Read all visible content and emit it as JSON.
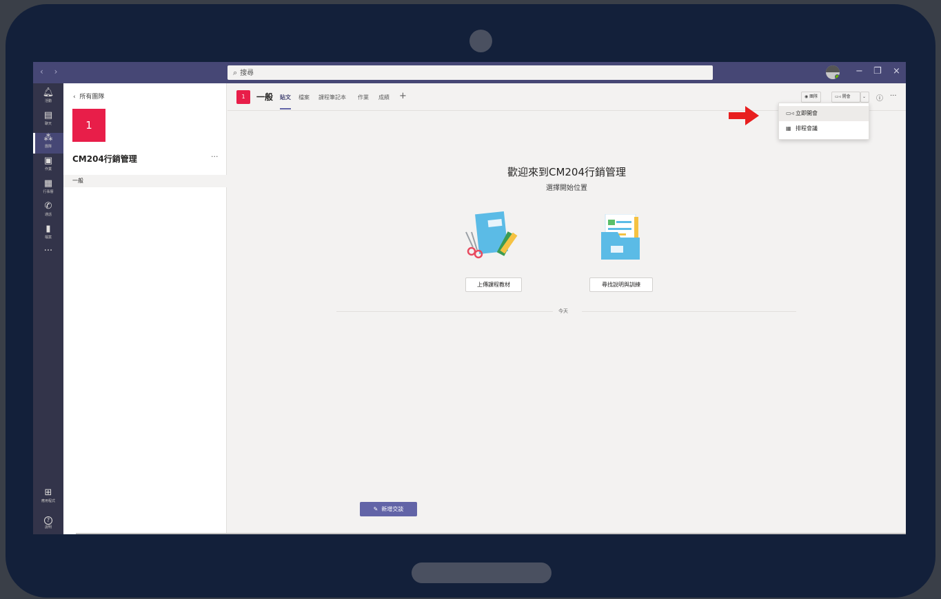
{
  "titlebar": {
    "nav_arrows": "‹ ›",
    "search_icon": "search-icon",
    "search_placeholder": "搜尋",
    "window_controls": [
      "−",
      "❐",
      "×"
    ]
  },
  "rail": {
    "items": [
      {
        "label": "活動",
        "icon": "bell-icon",
        "glyph": "🔔︎"
      },
      {
        "label": "聊天",
        "icon": "chat-icon",
        "glyph": "▤"
      },
      {
        "label": "團隊",
        "icon": "teams-icon",
        "glyph": "⁂"
      },
      {
        "label": "作業",
        "icon": "assignments-icon",
        "glyph": "▣"
      },
      {
        "label": "行事曆",
        "icon": "calendar-icon",
        "glyph": "▦"
      },
      {
        "label": "通話",
        "icon": "phone-icon",
        "glyph": "✆"
      },
      {
        "label": "檔案",
        "icon": "file-icon",
        "glyph": "▮"
      },
      {
        "label": "",
        "icon": "more-icon",
        "glyph": "···"
      }
    ],
    "bottom": [
      {
        "label": "應用程式",
        "icon": "apps-icon",
        "glyph": "⊞"
      },
      {
        "label": "說明",
        "icon": "help-icon",
        "glyph": "?"
      }
    ]
  },
  "team_panel": {
    "back_label": "所有團隊",
    "team_avatar": "1",
    "team_name": "CM204行銷管理",
    "more": "···",
    "channels": [
      "一般"
    ]
  },
  "channel_header": {
    "avatar": "1",
    "title": "一般",
    "tabs": [
      "貼文",
      "檔案",
      "課程筆記本",
      "作業",
      "成績"
    ],
    "add_tab": "+",
    "team_button": "團隊",
    "meet_button": "開會",
    "chevron": "⌄",
    "info": "ⓘ",
    "more": "···"
  },
  "meet_dropdown": {
    "items": [
      {
        "label": "立即開會",
        "icon": "video-icon"
      },
      {
        "label": "排程會議",
        "icon": "calendar-icon"
      }
    ]
  },
  "welcome": {
    "title": "歡迎來到CM204行銷管理",
    "subtitle": "選擇開始位置",
    "upload_button": "上傳課程教材",
    "help_button": "尋找說明與訓練",
    "today": "今天"
  },
  "new_conversation": "新增交談",
  "colors": {
    "accent": "#6264a7",
    "titlebar": "#464775",
    "team_red": "#e81e49",
    "arrow_red": "#e81e1e"
  }
}
